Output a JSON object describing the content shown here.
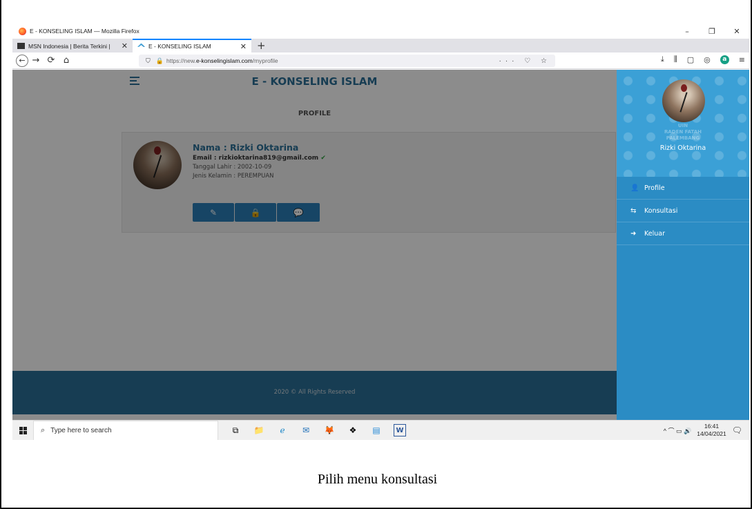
{
  "window": {
    "title": "E - KONSELING ISLAM — Mozilla Firefox",
    "controls": [
      "–",
      "❐",
      "✕"
    ]
  },
  "tabs": [
    {
      "label": "MSN Indonesia | Berita Terkini |",
      "close": "✕"
    },
    {
      "label": "E - KONSELING ISLAM",
      "close": "✕"
    }
  ],
  "new_tab": "+",
  "nav": {
    "back": "←",
    "forward": "→",
    "reload": "⟳",
    "home": "⌂",
    "url_prefix": "https://new.",
    "url_domain": "e-konselingislam.com",
    "url_path": "/myprofile",
    "url_actions": "··· ♡ ☆",
    "right_icons": [
      "⤓",
      "⫼",
      "▢",
      "◎"
    ],
    "account_letter": "a",
    "menu": "≡"
  },
  "page": {
    "brand": "E - KONSELING ISLAM",
    "heading": "PROFILE",
    "profile": {
      "name": "Nama : Rizki Oktarina",
      "email": "Email : rizkioktarina819@gmail.com",
      "email_check": "✔",
      "birth": "Tanggal Lahir : 2002-10-09",
      "gender": "Jenis Kelamin : PEREMPUAN"
    },
    "buttons": [
      "✎",
      "🔒",
      "💬"
    ],
    "footer": "2020 © All Rights Reserved"
  },
  "sidebar": {
    "watermark": "UIN\nRADEN FATAH\nPALEMBANG",
    "user_name": "Rizki Oktarina",
    "items": [
      {
        "icon": "👤",
        "label": "Profile"
      },
      {
        "icon": "⇆",
        "label": "Konsultasi"
      },
      {
        "icon": "➜",
        "label": "Keluar"
      }
    ]
  },
  "taskbar": {
    "search_placeholder": "Type here to search",
    "apps": [
      "⧉",
      "📁",
      "ℯ",
      "✉",
      "🦊",
      "❖",
      "▤",
      "W"
    ],
    "tray_icons": "^ ⌒ ▭ 🔊",
    "time": "16:41",
    "date": "14/04/2021"
  },
  "caption": "Pilih menu konsultasi"
}
